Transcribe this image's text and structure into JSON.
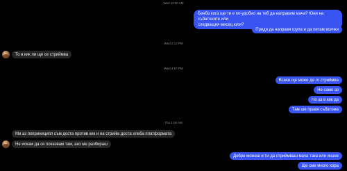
{
  "timestamps": {
    "t1": "Wed 11:30 AM",
    "t2": "Wed 2:12 PM",
    "t3": "Wed 4:57 PM",
    "t4": "Thu 1:00 AM"
  },
  "messages": {
    "m1_line1": "Бенба кога ще ти е по-удобно на теб да направим мача? Юни на събатоните или",
    "m1_line2": "следващия месец юли?",
    "m2": "Преди да направя група и да питам всички",
    "m3": "То в кик ли ще се стриймва",
    "m4": "Всеки ще може да го стриймва",
    "m5": "Не само аз",
    "m6": "Но аз в кик да",
    "m7": "Там ше правя събатома",
    "m8": "Ми аз поприниципп съм доста против кик и на стрийм доста хлеба платформата",
    "m9": "Не искам да се показвам там, ако ме разбираш",
    "m10": "Добре можеш и ти да стриймваш мача така или иначе",
    "m11": "Ще сме много хора"
  },
  "colors": {
    "outgoing": "#3a54f2",
    "incoming": "#262626",
    "background": "#000000"
  }
}
